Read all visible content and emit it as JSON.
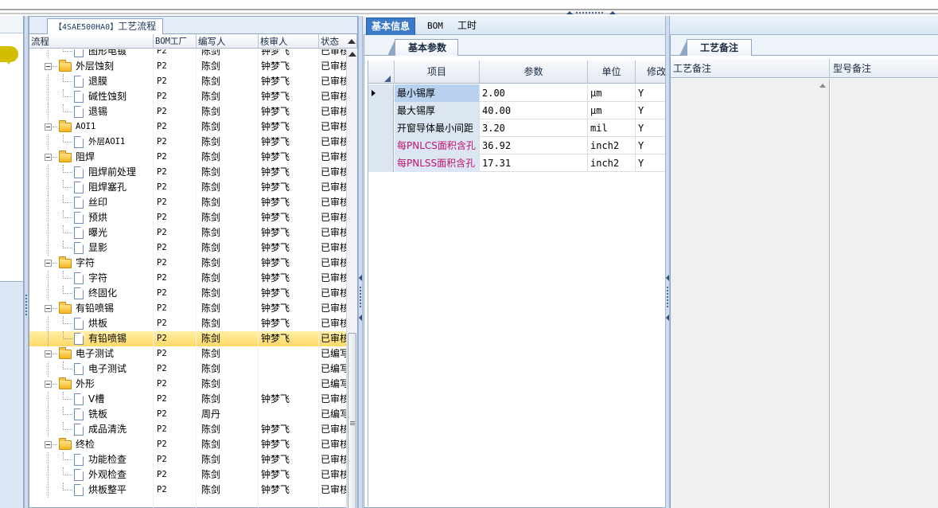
{
  "tree_tab": {
    "code": "【4SAE500HA0】",
    "label": "工艺流程"
  },
  "tree_columns": [
    "流程",
    "BOM工厂",
    "编写人",
    "核审人",
    "状态"
  ],
  "tree_rows": [
    {
      "level": 1,
      "type": "doc",
      "name": "图形电镀",
      "bom": "P2",
      "writer": "陈剑",
      "reviewer": "钟梦飞",
      "status": "已审核"
    },
    {
      "level": 0,
      "type": "folder",
      "name": "外层蚀刻",
      "bom": "P2",
      "writer": "陈剑",
      "reviewer": "钟梦飞",
      "status": "已审核"
    },
    {
      "level": 1,
      "type": "doc",
      "name": "退膜",
      "bom": "P2",
      "writer": "陈剑",
      "reviewer": "钟梦飞",
      "status": "已审核"
    },
    {
      "level": 1,
      "type": "doc",
      "name": "碱性蚀刻",
      "bom": "P2",
      "writer": "陈剑",
      "reviewer": "钟梦飞",
      "status": "已审核"
    },
    {
      "level": 1,
      "type": "doc",
      "name": "退锡",
      "bom": "P2",
      "writer": "陈剑",
      "reviewer": "钟梦飞",
      "status": "已审核"
    },
    {
      "level": 0,
      "type": "folder",
      "name": "AOI1",
      "bom": "P2",
      "writer": "陈剑",
      "reviewer": "钟梦飞",
      "status": "已审核"
    },
    {
      "level": 1,
      "type": "doc",
      "name": "外层AOI1",
      "bom": "P2",
      "writer": "陈剑",
      "reviewer": "钟梦飞",
      "status": "已审核"
    },
    {
      "level": 0,
      "type": "folder",
      "name": "阻焊",
      "bom": "P2",
      "writer": "陈剑",
      "reviewer": "钟梦飞",
      "status": "已审核"
    },
    {
      "level": 1,
      "type": "doc",
      "name": "阻焊前处理",
      "bom": "P2",
      "writer": "陈剑",
      "reviewer": "钟梦飞",
      "status": "已审核"
    },
    {
      "level": 1,
      "type": "doc",
      "name": "阻焊塞孔",
      "bom": "P2",
      "writer": "陈剑",
      "reviewer": "钟梦飞",
      "status": "已审核"
    },
    {
      "level": 1,
      "type": "doc",
      "name": "丝印",
      "bom": "P2",
      "writer": "陈剑",
      "reviewer": "钟梦飞",
      "status": "已审核"
    },
    {
      "level": 1,
      "type": "doc",
      "name": "预烘",
      "bom": "P2",
      "writer": "陈剑",
      "reviewer": "钟梦飞",
      "status": "已审核"
    },
    {
      "level": 1,
      "type": "doc",
      "name": "曝光",
      "bom": "P2",
      "writer": "陈剑",
      "reviewer": "钟梦飞",
      "status": "已审核"
    },
    {
      "level": 1,
      "type": "doc",
      "name": "显影",
      "bom": "P2",
      "writer": "陈剑",
      "reviewer": "钟梦飞",
      "status": "已审核"
    },
    {
      "level": 0,
      "type": "folder",
      "name": "字符",
      "bom": "P2",
      "writer": "陈剑",
      "reviewer": "钟梦飞",
      "status": "已审核"
    },
    {
      "level": 1,
      "type": "doc",
      "name": "字符",
      "bom": "P2",
      "writer": "陈剑",
      "reviewer": "钟梦飞",
      "status": "已审核"
    },
    {
      "level": 1,
      "type": "doc",
      "name": "终固化",
      "bom": "P2",
      "writer": "陈剑",
      "reviewer": "钟梦飞",
      "status": "已审核"
    },
    {
      "level": 0,
      "type": "folder",
      "name": "有铅喷锡",
      "bom": "P2",
      "writer": "陈剑",
      "reviewer": "钟梦飞",
      "status": "已审核"
    },
    {
      "level": 1,
      "type": "doc",
      "name": "烘板",
      "bom": "P2",
      "writer": "陈剑",
      "reviewer": "钟梦飞",
      "status": "已审核"
    },
    {
      "level": 1,
      "type": "doc",
      "name": "有铅喷锡",
      "bom": "P2",
      "writer": "陈剑",
      "reviewer": "钟梦飞",
      "status": "已审核",
      "selected": true
    },
    {
      "level": 0,
      "type": "folder",
      "name": "电子测试",
      "bom": "P2",
      "writer": "陈剑",
      "reviewer": "",
      "status": "已编写"
    },
    {
      "level": 1,
      "type": "doc",
      "name": "电子测试",
      "bom": "P2",
      "writer": "陈剑",
      "reviewer": "",
      "status": "已编写"
    },
    {
      "level": 0,
      "type": "folder",
      "name": "外形",
      "bom": "P2",
      "writer": "陈剑",
      "reviewer": "",
      "status": "已编写"
    },
    {
      "level": 1,
      "type": "doc",
      "name": "V槽",
      "bom": "P2",
      "writer": "陈剑",
      "reviewer": "钟梦飞",
      "status": "已审核"
    },
    {
      "level": 1,
      "type": "doc",
      "name": "铣板",
      "bom": "P2",
      "writer": "周丹",
      "reviewer": "",
      "status": "已编写"
    },
    {
      "level": 1,
      "type": "doc",
      "name": "成品清洗",
      "bom": "P2",
      "writer": "陈剑",
      "reviewer": "钟梦飞",
      "status": "已审核"
    },
    {
      "level": 0,
      "type": "folder",
      "name": "终检",
      "bom": "P2",
      "writer": "陈剑",
      "reviewer": "钟梦飞",
      "status": "已审核"
    },
    {
      "level": 1,
      "type": "doc",
      "name": "功能检查",
      "bom": "P2",
      "writer": "陈剑",
      "reviewer": "钟梦飞",
      "status": "已审核"
    },
    {
      "level": 1,
      "type": "doc",
      "name": "外观检查",
      "bom": "P2",
      "writer": "陈剑",
      "reviewer": "钟梦飞",
      "status": "已审核"
    },
    {
      "level": 1,
      "type": "doc",
      "name": "烘板整平",
      "bom": "P2",
      "writer": "陈剑",
      "reviewer": "钟梦飞",
      "status": "已审核"
    }
  ],
  "main_tabs": [
    "基本信息",
    "BOM",
    "工时"
  ],
  "params_tab": "基本参数",
  "params_columns": [
    "项目",
    "参数",
    "单位",
    "修改"
  ],
  "params_rows": [
    {
      "item": "最小锡厚",
      "value": "2.00",
      "unit": "μm",
      "mod": "Y",
      "pink": false,
      "current": true
    },
    {
      "item": "最大锡厚",
      "value": "40.00",
      "unit": "μm",
      "mod": "Y",
      "pink": false
    },
    {
      "item": "开窗导体最小间距",
      "value": "3.20",
      "unit": "mil",
      "mod": "Y",
      "pink": false
    },
    {
      "item": "每PNLCS面积含孔",
      "value": "36.92",
      "unit": "inch2",
      "mod": "Y",
      "pink": true
    },
    {
      "item": "每PNLSS面积含孔",
      "value": "17.31",
      "unit": "inch2",
      "mod": "Y",
      "pink": true
    }
  ],
  "notes_tab": "工艺备注",
  "notes_columns": [
    "工艺备注",
    "型号备注"
  ],
  "colors": {
    "accent": "#3b7ac8",
    "selected_row": "#ffd966",
    "pink_text": "#c0126f"
  }
}
